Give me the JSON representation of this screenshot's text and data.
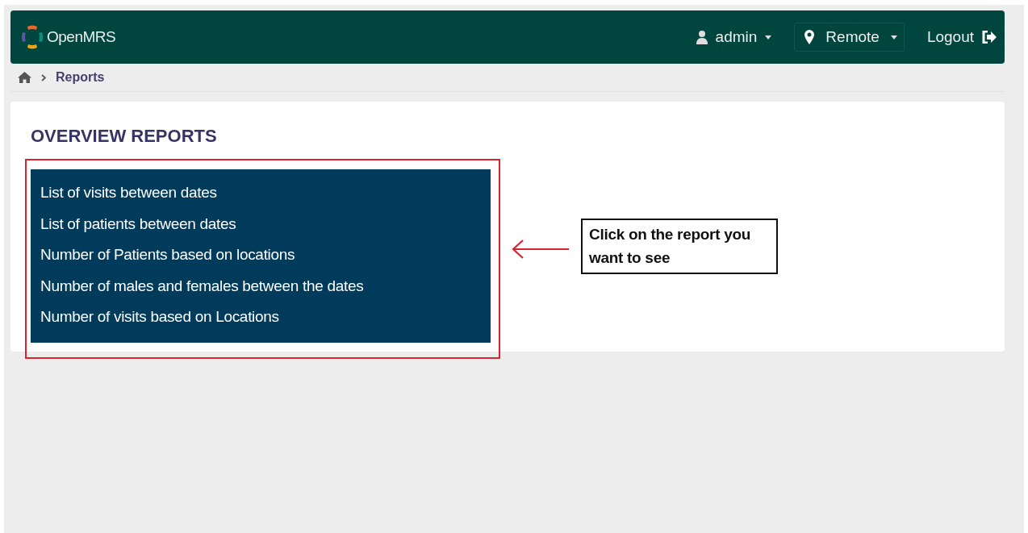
{
  "header": {
    "brand": "OpenMRS",
    "user": "admin",
    "location": "Remote",
    "logout": "Logout"
  },
  "breadcrumb": {
    "current": "Reports"
  },
  "section": {
    "title": "OVERVIEW REPORTS",
    "reports": [
      {
        "label": "List of visits between dates"
      },
      {
        "label": "List of patients between dates"
      },
      {
        "label": "Number of Patients based on locations"
      },
      {
        "label": "Number of males and females between the dates"
      },
      {
        "label": "Number of visits based on Locations"
      }
    ]
  },
  "callout": {
    "text": "Click on the report you want to see"
  }
}
